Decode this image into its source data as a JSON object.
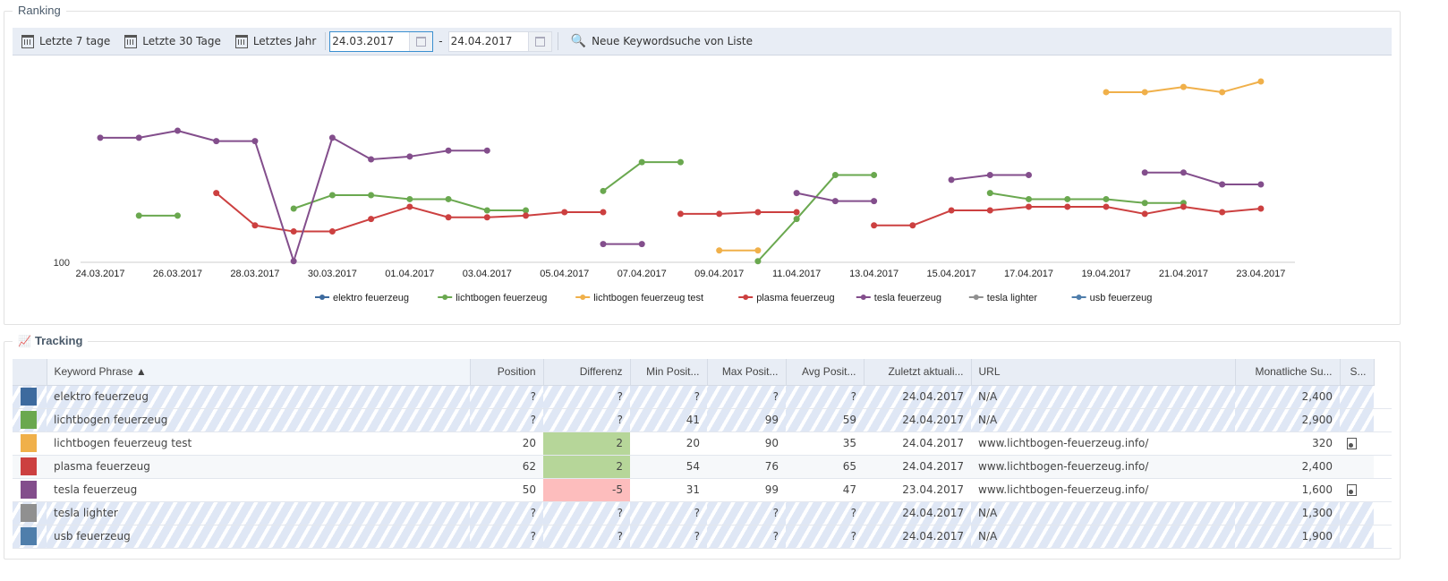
{
  "ranking": {
    "title": "Ranking",
    "toolbar": {
      "last7": "Letzte 7 tage",
      "last30": "Letzte 30 Tage",
      "lastYear": "Letztes Jahr",
      "from": "24.03.2017",
      "dash": "-",
      "to": "24.04.2017",
      "newSearch": "Neue Keywordsuche von Liste"
    }
  },
  "chart_data": {
    "type": "line",
    "x": [
      "24.03.2017",
      "25.03.2017",
      "26.03.2017",
      "27.03.2017",
      "28.03.2017",
      "29.03.2017",
      "30.03.2017",
      "31.03.2017",
      "01.04.2017",
      "02.04.2017",
      "03.04.2017",
      "04.04.2017",
      "05.04.2017",
      "06.04.2017",
      "07.04.2017",
      "08.04.2017",
      "09.04.2017",
      "10.04.2017",
      "11.04.2017",
      "12.04.2017",
      "13.04.2017",
      "14.04.2017",
      "15.04.2017",
      "16.04.2017",
      "17.04.2017",
      "18.04.2017",
      "19.04.2017",
      "20.04.2017",
      "21.04.2017",
      "22.04.2017",
      "23.04.2017"
    ],
    "x_tick_labels": [
      "24.03.2017",
      "26.03.2017",
      "28.03.2017",
      "30.03.2017",
      "01.04.2017",
      "03.04.2017",
      "05.04.2017",
      "07.04.2017",
      "09.04.2017",
      "11.04.2017",
      "13.04.2017",
      "15.04.2017",
      "17.04.2017",
      "19.04.2017",
      "21.04.2017",
      "23.04.2017"
    ],
    "y_tick_labels": [
      "100"
    ],
    "y_scale": "log",
    "y_reversed": true,
    "ylim": [
      17.5,
      100
    ],
    "legend_position": "bottom",
    "series": [
      {
        "name": "elektro feuerzeug",
        "color": "#3d6a9e",
        "values": []
      },
      {
        "name": "lichtbogen feuerzeug",
        "color": "#6aa84f",
        "values": [
          null,
          66,
          66,
          null,
          null,
          62,
          55,
          55,
          57,
          57,
          63,
          63,
          null,
          53,
          41,
          41,
          null,
          99,
          68,
          46,
          46,
          null,
          null,
          54,
          57,
          57,
          57,
          59,
          59,
          null,
          null
        ]
      },
      {
        "name": "lichtbogen feuerzeug test",
        "color": "#f0b04a",
        "values": [
          null,
          null,
          null,
          null,
          null,
          null,
          null,
          null,
          null,
          null,
          null,
          null,
          null,
          null,
          null,
          null,
          90,
          90,
          null,
          null,
          null,
          null,
          null,
          null,
          null,
          null,
          22,
          22,
          21,
          22,
          20
        ]
      },
      {
        "name": "plasma feuerzeug",
        "color": "#cc4040",
        "values": [
          null,
          null,
          null,
          54,
          72,
          76,
          76,
          68,
          61,
          67,
          67,
          66,
          64,
          64,
          null,
          65,
          65,
          64,
          64,
          null,
          72,
          72,
          63,
          63,
          61,
          61,
          61,
          65,
          61,
          64,
          62
        ]
      },
      {
        "name": "tesla feuerzeug",
        "color": "#834e8c",
        "values": [
          33,
          33,
          31,
          34,
          34,
          99,
          33,
          40,
          39,
          37,
          37,
          null,
          null,
          85,
          85,
          null,
          null,
          null,
          54,
          58,
          58,
          null,
          48,
          46,
          46,
          null,
          null,
          45,
          45,
          50,
          50
        ]
      },
      {
        "name": "tesla lighter",
        "color": "#909090",
        "values": []
      },
      {
        "name": "usb feuerzeug",
        "color": "#4f7eab",
        "values": []
      }
    ]
  },
  "tracking": {
    "title": "Tracking",
    "columns": [
      "Keyword Phrase ▲",
      "Position",
      "Differenz",
      "Min Posit...",
      "Max Posit...",
      "Avg Posit...",
      "Zuletzt aktuali...",
      "URL",
      "Monatliche Su...",
      "S..."
    ],
    "rows": [
      {
        "color": "#3d6a9e",
        "keyword": "elektro feuerzeug",
        "position": "?",
        "diff": "?",
        "min": "?",
        "max": "?",
        "avg": "?",
        "updated": "24.04.2017",
        "url": "N/A",
        "monthly": "2,400",
        "shot": false,
        "style": "striped"
      },
      {
        "color": "#6aa84f",
        "keyword": "lichtbogen feuerzeug",
        "position": "?",
        "diff": "?",
        "min": "41",
        "max": "99",
        "avg": "59",
        "updated": "24.04.2017",
        "url": "N/A",
        "monthly": "2,900",
        "shot": false,
        "style": "striped"
      },
      {
        "color": "#f0b04a",
        "keyword": "lichtbogen feuerzeug test",
        "position": "20",
        "diff": "2",
        "min": "20",
        "max": "90",
        "avg": "35",
        "updated": "24.04.2017",
        "url": "www.lichtbogen-feuerzeug.info/",
        "monthly": "320",
        "shot": true,
        "style": "plain",
        "diffClass": "pos"
      },
      {
        "color": "#cc4040",
        "keyword": "plasma feuerzeug",
        "position": "62",
        "diff": "2",
        "min": "54",
        "max": "76",
        "avg": "65",
        "updated": "24.04.2017",
        "url": "www.lichtbogen-feuerzeug.info/",
        "monthly": "2,400",
        "shot": false,
        "style": "alt",
        "diffClass": "pos"
      },
      {
        "color": "#834e8c",
        "keyword": "tesla feuerzeug",
        "position": "50",
        "diff": "-5",
        "min": "31",
        "max": "99",
        "avg": "47",
        "updated": "23.04.2017",
        "url": "www.lichtbogen-feuerzeug.info/",
        "monthly": "1,600",
        "shot": true,
        "style": "plain",
        "diffClass": "neg"
      },
      {
        "color": "#909090",
        "keyword": "tesla lighter",
        "position": "?",
        "diff": "?",
        "min": "?",
        "max": "?",
        "avg": "?",
        "updated": "24.04.2017",
        "url": "N/A",
        "monthly": "1,300",
        "shot": false,
        "style": "striped"
      },
      {
        "color": "#4f7eab",
        "keyword": "usb feuerzeug",
        "position": "?",
        "diff": "?",
        "min": "?",
        "max": "?",
        "avg": "?",
        "updated": "24.04.2017",
        "url": "N/A",
        "monthly": "1,900",
        "shot": false,
        "style": "striped"
      }
    ]
  }
}
